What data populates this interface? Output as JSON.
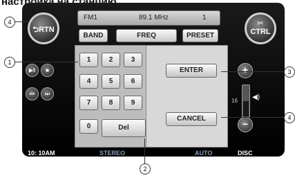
{
  "heading": "настройка на станцию",
  "display": {
    "band": "FM1",
    "frequency": "89.1 MHz",
    "preset": "1"
  },
  "top_buttons": {
    "band": "BAND",
    "freq": "FREQ",
    "preset": "PRESET"
  },
  "side_buttons": {
    "rtn": "RTN",
    "ctrl": "CTRL"
  },
  "keypad": {
    "keys": [
      "1",
      "2",
      "3",
      "4",
      "5",
      "6",
      "7",
      "8",
      "9",
      "0"
    ],
    "del": "Del"
  },
  "actions": {
    "enter": "ENTER",
    "cancel": "CANCEL"
  },
  "volume": {
    "value": "16",
    "level_fraction": 0.5
  },
  "status": {
    "time": "10: 10AM",
    "mode": "STEREO",
    "auto": "AUTO",
    "source": "DISC"
  },
  "callouts": [
    "4",
    "1",
    "2",
    "3",
    "4"
  ],
  "colors": {
    "status_text": "#8a9fb7",
    "device_bg": "#000000"
  }
}
